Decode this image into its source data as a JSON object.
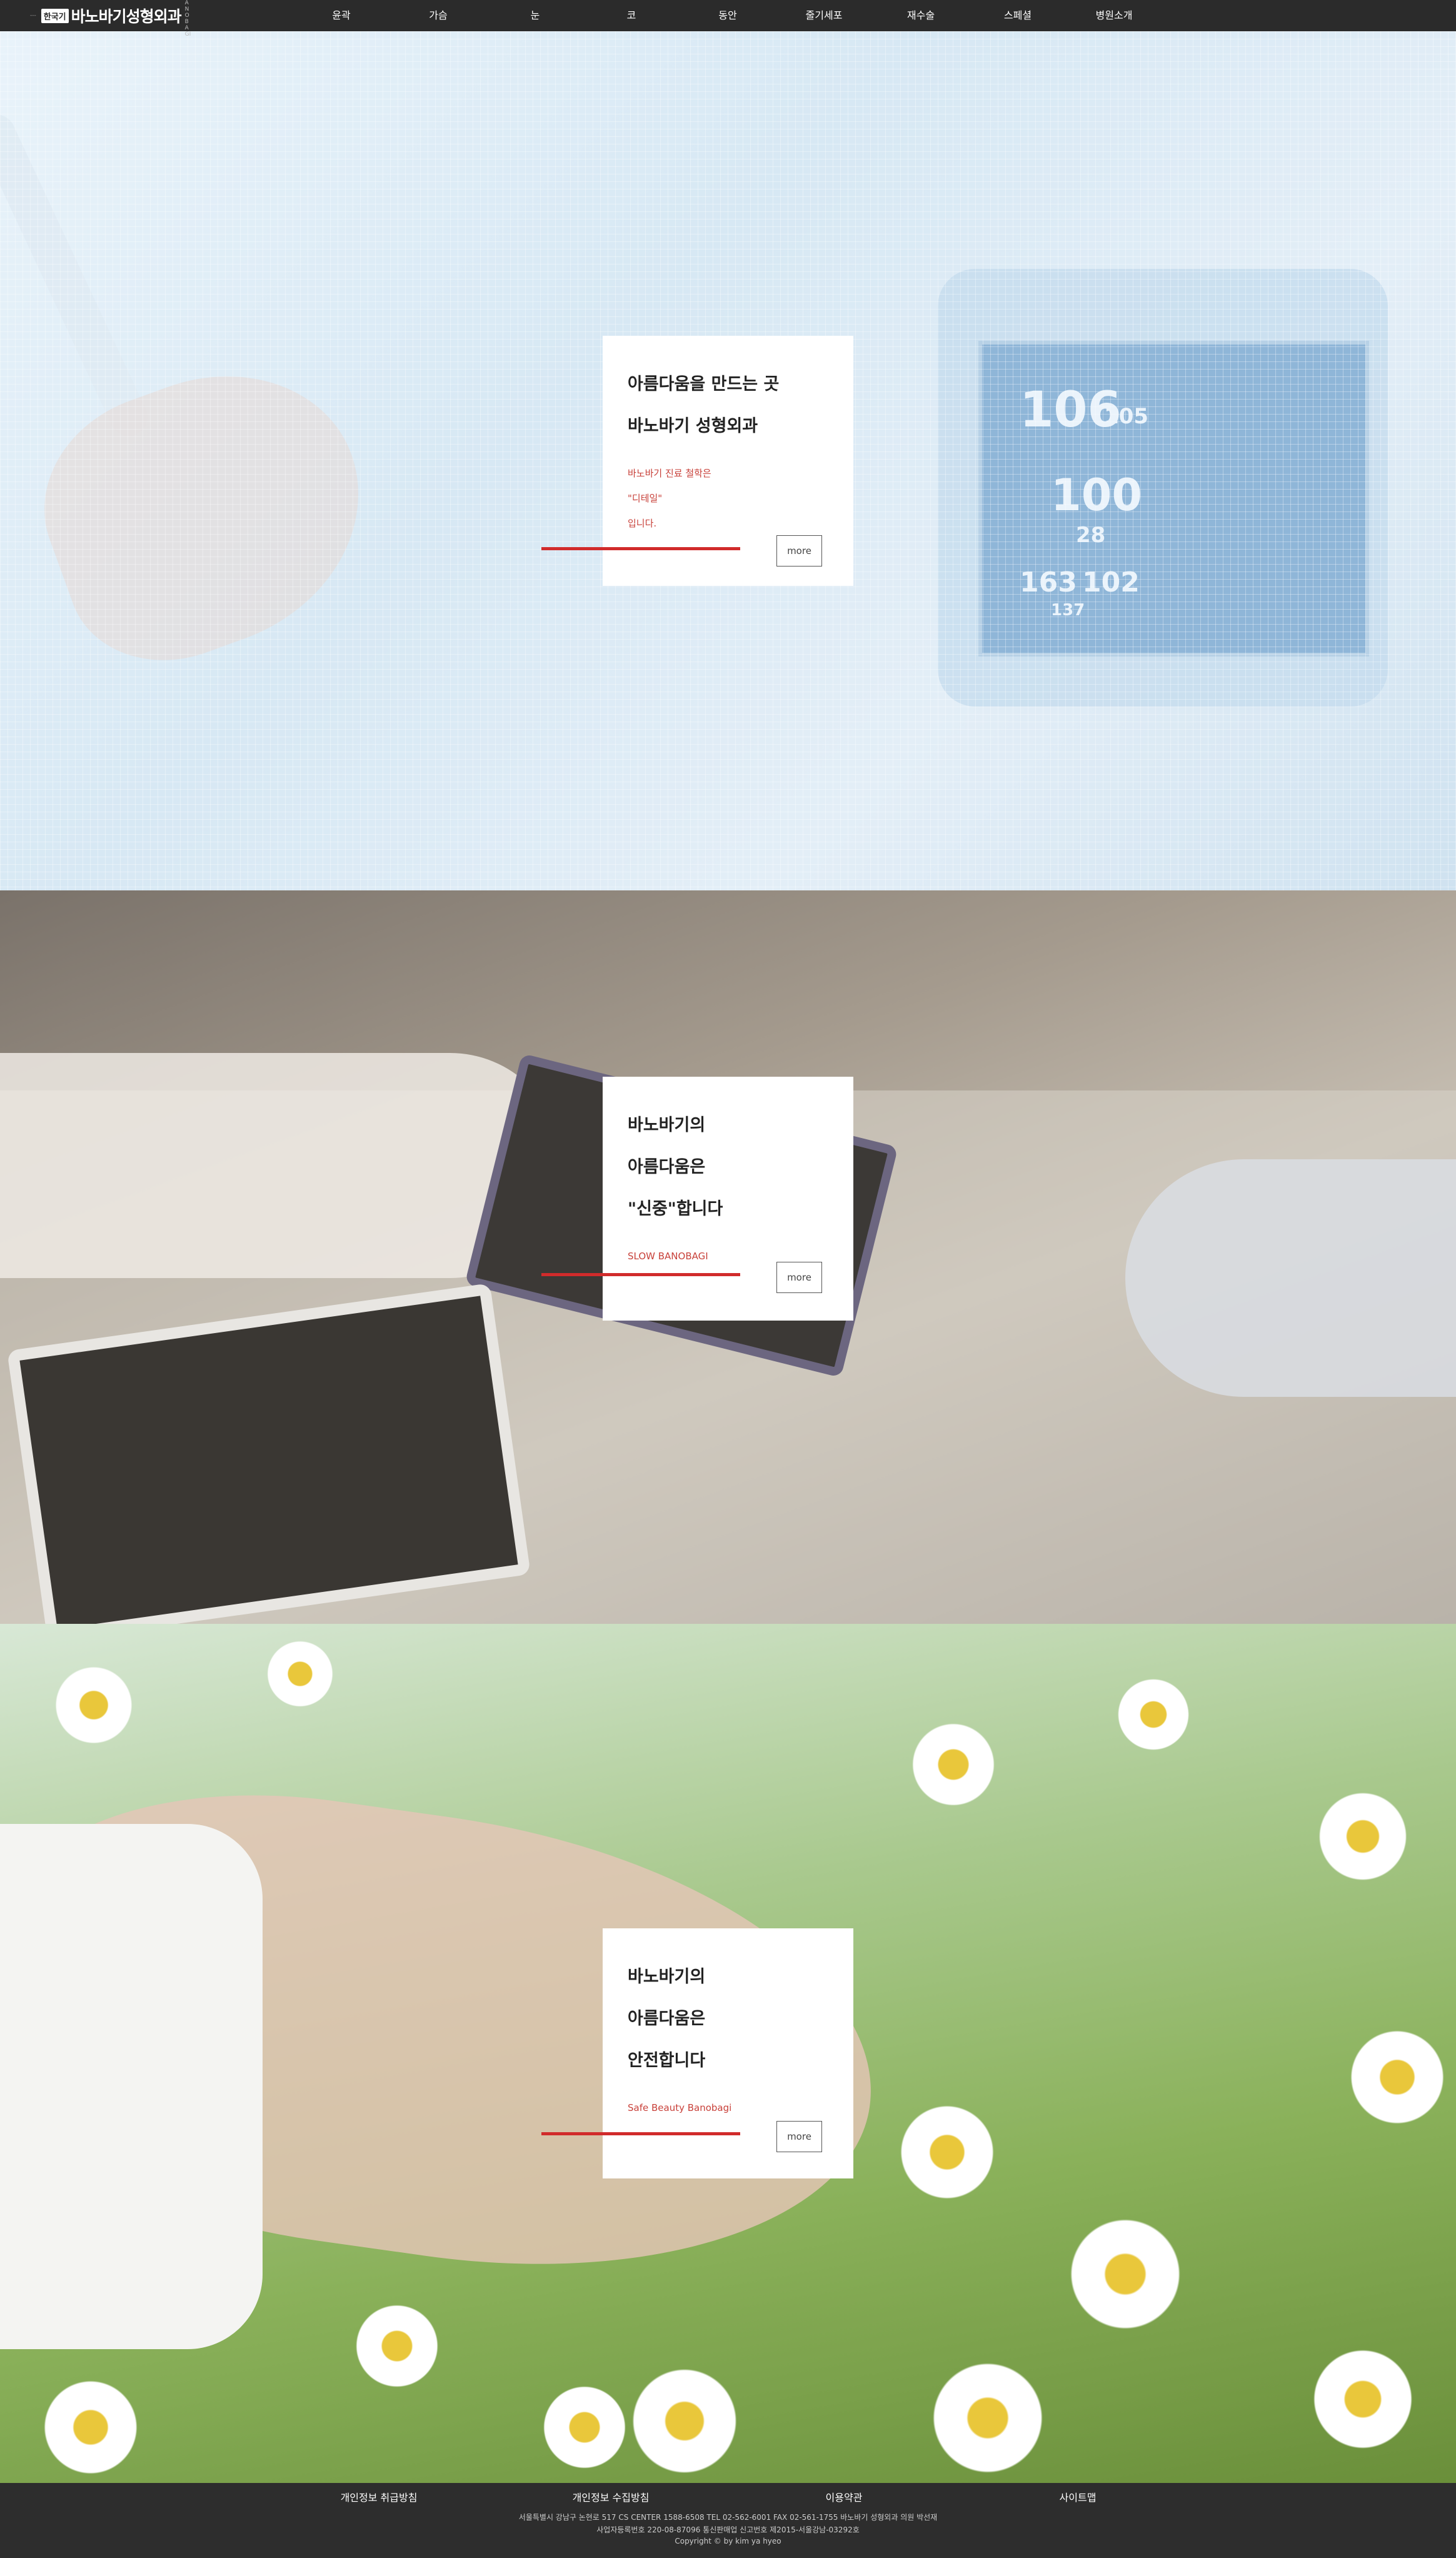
{
  "header": {
    "logo_mark": "---",
    "logo_box": "한국기",
    "logo_text": "바노바기성형외과",
    "logo_sub": "BANOBAGI",
    "nav": [
      "윤곽",
      "가슴",
      "눈",
      "코",
      "동안",
      "줄기세포",
      "재수술",
      "스페셜",
      "병원소개"
    ]
  },
  "sections": [
    {
      "title_lines": [
        "아름다움을 만드는 곳",
        "바노바기 성형외과"
      ],
      "sub_lines": [
        "바노바기 진료 철학은",
        "\"디테일\"",
        "입니다."
      ],
      "more_label": "more",
      "monitor_values": [
        "106",
        "105",
        "100",
        "28",
        "163",
        "102",
        "137"
      ]
    },
    {
      "title_lines": [
        "바노바기의",
        "아름다움은",
        "\"신중\"합니다"
      ],
      "sub_lines": [
        "SLOW BANOBAGI"
      ],
      "more_label": "more"
    },
    {
      "title_lines": [
        "바노바기의",
        "아름다움은",
        "안전합니다"
      ],
      "sub_lines": [
        "Safe Beauty Banobagi"
      ],
      "more_label": "more"
    }
  ],
  "footer": {
    "links": [
      "개인정보 취급방침",
      "개인정보 수집방침",
      "이용약관",
      "사이트맵"
    ],
    "address": "서울특별시 강남구 논현로 517 CS CENTER 1588-6508 TEL 02-562-6001 FAX 02-561-1755 바노바기 성형외과 의원 박선재",
    "business": "사업자등록번호 220-08-87096 통신판매업 신고번호 제2015-서울강남-03292호",
    "copyright": "Copyright © by kim ya hyeo"
  },
  "colors": {
    "accent": "#d12b2b",
    "nav_bg": "#2b2b2b",
    "sub_text": "#c8413a"
  }
}
